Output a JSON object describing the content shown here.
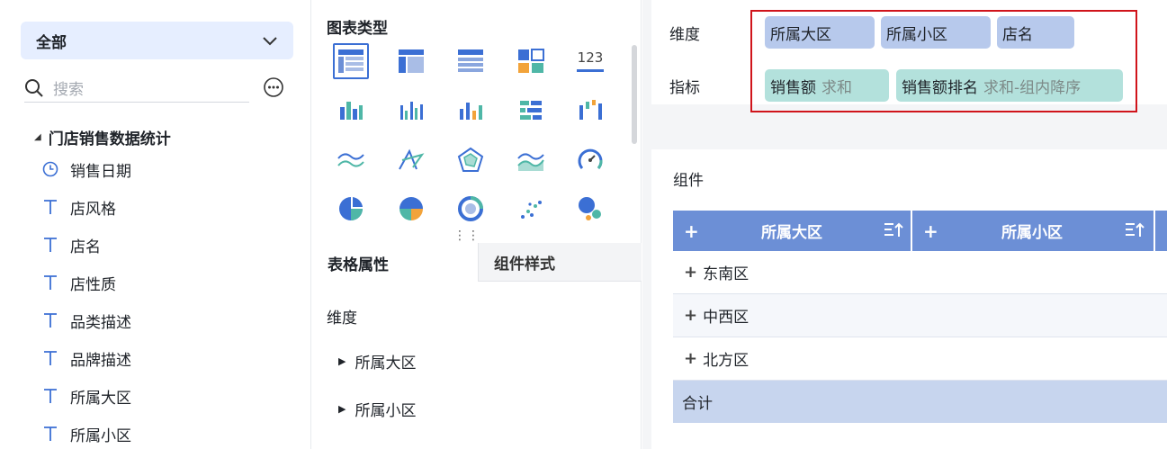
{
  "left": {
    "scope_label": "全部",
    "search_placeholder": "搜索",
    "tree_root": "门店销售数据统计",
    "fields": [
      {
        "label": "销售日期",
        "icon": "clock-icon"
      },
      {
        "label": "店风格",
        "icon": "text-type-icon"
      },
      {
        "label": "店名",
        "icon": "text-type-icon"
      },
      {
        "label": "店性质",
        "icon": "text-type-icon"
      },
      {
        "label": "品类描述",
        "icon": "text-type-icon"
      },
      {
        "label": "品牌描述",
        "icon": "text-type-icon"
      },
      {
        "label": "所属大区",
        "icon": "text-type-icon"
      },
      {
        "label": "所属小区",
        "icon": "text-type-icon"
      }
    ]
  },
  "middle": {
    "chart_type_title": "图表类型",
    "number_icon_text": "123",
    "tabs": {
      "table_props": "表格属性",
      "component_style": "组件样式"
    },
    "dimension_label": "维度",
    "dimension_nodes": [
      "所属大区",
      "所属小区"
    ]
  },
  "right": {
    "dimension_label": "维度",
    "metric_label": "指标",
    "dimension_chips": [
      "所属大区",
      "所属小区",
      "店名"
    ],
    "metric_chips": [
      {
        "name": "销售额",
        "agg": "求和"
      },
      {
        "name": "销售额排名",
        "agg": "求和-组内降序"
      }
    ],
    "component_title": "组件",
    "table": {
      "headers": [
        {
          "plus": "+",
          "title": "所属大区"
        },
        {
          "plus": "+",
          "title": "所属小区"
        }
      ],
      "rows": [
        {
          "plus": "+",
          "label": "东南区"
        },
        {
          "plus": "+",
          "label": "中西区"
        },
        {
          "plus": "+",
          "label": "北方区"
        }
      ],
      "total_label": "合计"
    }
  },
  "colors": {
    "accent": "#3b6fd4",
    "header_blue": "#6c8fd6",
    "dim_chip": "#b7c9ec",
    "metric_chip": "#b3e1dc",
    "highlight": "#d0141b"
  }
}
